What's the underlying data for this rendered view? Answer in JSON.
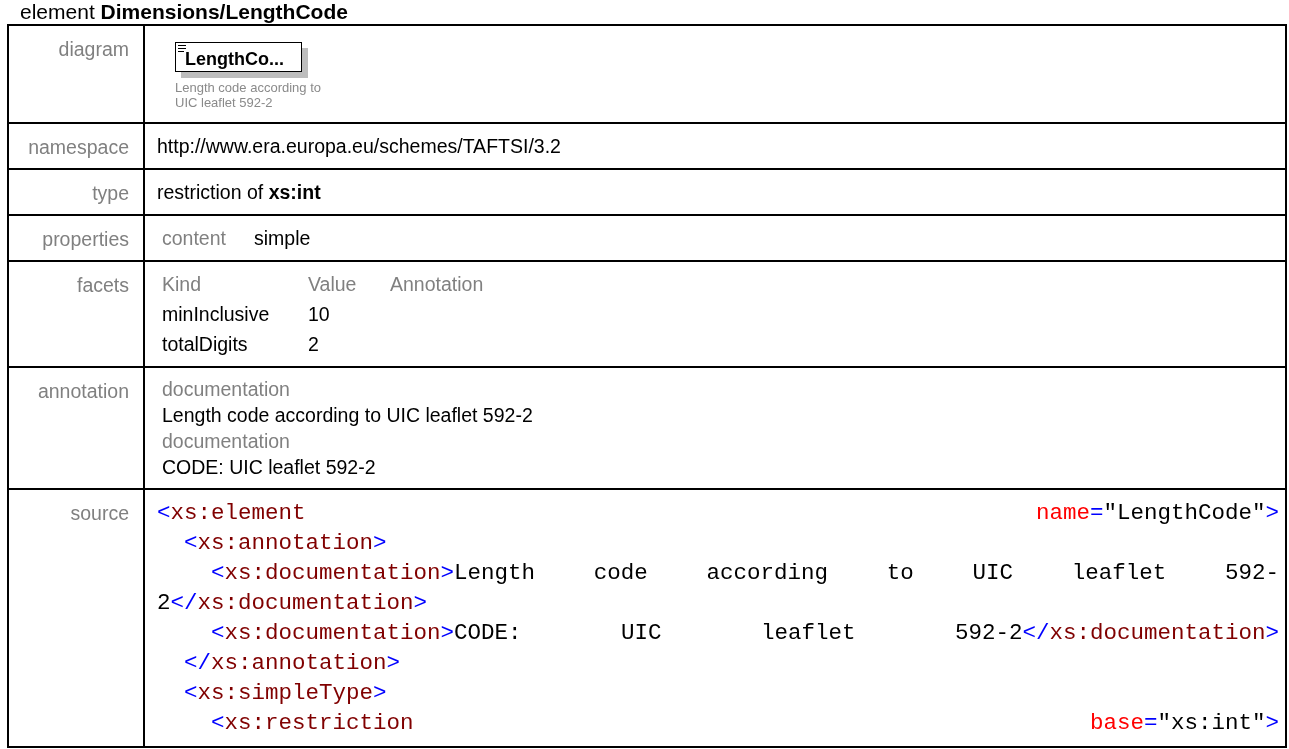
{
  "heading": "element **Dimensions/LengthCode**",
  "rows": [
    {
      "kind": "diagram",
      "label": "diagram",
      "node": "LengthCo...",
      "caption": [
        "Length code according to",
        "UIC leaflet 592-2"
      ]
    },
    {
      "kind": "text",
      "label": "namespace",
      "value": "http://www.era.europa.eu/schemes/TAFTSI/3.2"
    },
    {
      "kind": "text",
      "label": "type",
      "value": "restriction of **xs:int**"
    },
    {
      "kind": "properties",
      "label": "properties",
      "items": [
        {
          "key": "content",
          "value": "simple"
        }
      ]
    },
    {
      "kind": "facets",
      "label": "facets",
      "headings": [
        "Kind",
        "Value",
        "Annotation"
      ],
      "facets": [
        {
          "name": "minInclusive",
          "value": "10"
        },
        {
          "name": "totalDigits",
          "value": "2"
        }
      ]
    },
    {
      "kind": "annotation",
      "label": "annotation",
      "entries": [
        {
          "key": "documentation",
          "value": "Length code according to UIC leaflet 592-2"
        },
        {
          "key": "documentation",
          "value": "CODE: UIC leaflet 592-2"
        }
      ]
    },
    {
      "kind": "source",
      "label": "source",
      "lines": [
        [
          [
            {
              "kind": "bracket",
              "text": "<"
            },
            {
              "kind": "tag",
              "text": "xs:element"
            }
          ],
          [
            {
              "kind": "attr",
              "text": "name"
            },
            {
              "kind": "bracket",
              "text": "="
            },
            {
              "kind": "value",
              "text": "\"LengthCode\""
            },
            {
              "kind": "bracket",
              "text": ">"
            }
          ]
        ],
        [
          [
            {
              "kind": "bracket",
              "text": "  <"
            },
            {
              "kind": "tag",
              "text": "xs:annotation"
            },
            {
              "kind": "bracket",
              "text": ">"
            }
          ]
        ],
        [
          [
            {
              "kind": "bracket",
              "text": "    <"
            },
            {
              "kind": "tag",
              "text": "xs:documentation"
            },
            {
              "kind": "bracket",
              "text": ">"
            },
            {
              "kind": "value",
              "text": "Length"
            }
          ],
          [
            {
              "kind": "value",
              "text": "code"
            }
          ],
          [
            {
              "kind": "value",
              "text": "according"
            }
          ],
          [
            {
              "kind": "value",
              "text": "to"
            }
          ],
          [
            {
              "kind": "value",
              "text": "UIC"
            }
          ],
          [
            {
              "kind": "value",
              "text": "leaflet"
            }
          ],
          [
            {
              "kind": "value",
              "text": "592-"
            }
          ]
        ],
        [
          [
            {
              "kind": "value",
              "text": "2"
            },
            {
              "kind": "bracket",
              "text": "</"
            },
            {
              "kind": "tag",
              "text": "xs:documentation"
            },
            {
              "kind": "bracket",
              "text": ">"
            }
          ]
        ],
        [
          [
            {
              "kind": "bracket",
              "text": "    <"
            },
            {
              "kind": "tag",
              "text": "xs:documentation"
            },
            {
              "kind": "bracket",
              "text": ">"
            },
            {
              "kind": "value",
              "text": "CODE:"
            }
          ],
          [
            {
              "kind": "value",
              "text": "UIC"
            }
          ],
          [
            {
              "kind": "value",
              "text": "leaflet"
            }
          ],
          [
            {
              "kind": "value",
              "text": "592-2"
            },
            {
              "kind": "bracket",
              "text": "</"
            },
            {
              "kind": "tag",
              "text": "xs:documentation"
            },
            {
              "kind": "bracket",
              "text": ">"
            }
          ]
        ],
        [
          [
            {
              "kind": "bracket",
              "text": "  </"
            },
            {
              "kind": "tag",
              "text": "xs:annotation"
            },
            {
              "kind": "bracket",
              "text": ">"
            }
          ]
        ],
        [
          [
            {
              "kind": "bracket",
              "text": "  <"
            },
            {
              "kind": "tag",
              "text": "xs:simpleType"
            },
            {
              "kind": "bracket",
              "text": ">"
            }
          ]
        ],
        [
          [
            {
              "kind": "bracket",
              "text": "    <"
            },
            {
              "kind": "tag",
              "text": "xs:restriction"
            }
          ],
          [
            {
              "kind": "attr",
              "text": "base"
            },
            {
              "kind": "bracket",
              "text": "="
            },
            {
              "kind": "value",
              "text": "\"xs:int\""
            },
            {
              "kind": "bracket",
              "text": ">"
            }
          ]
        ]
      ]
    }
  ]
}
